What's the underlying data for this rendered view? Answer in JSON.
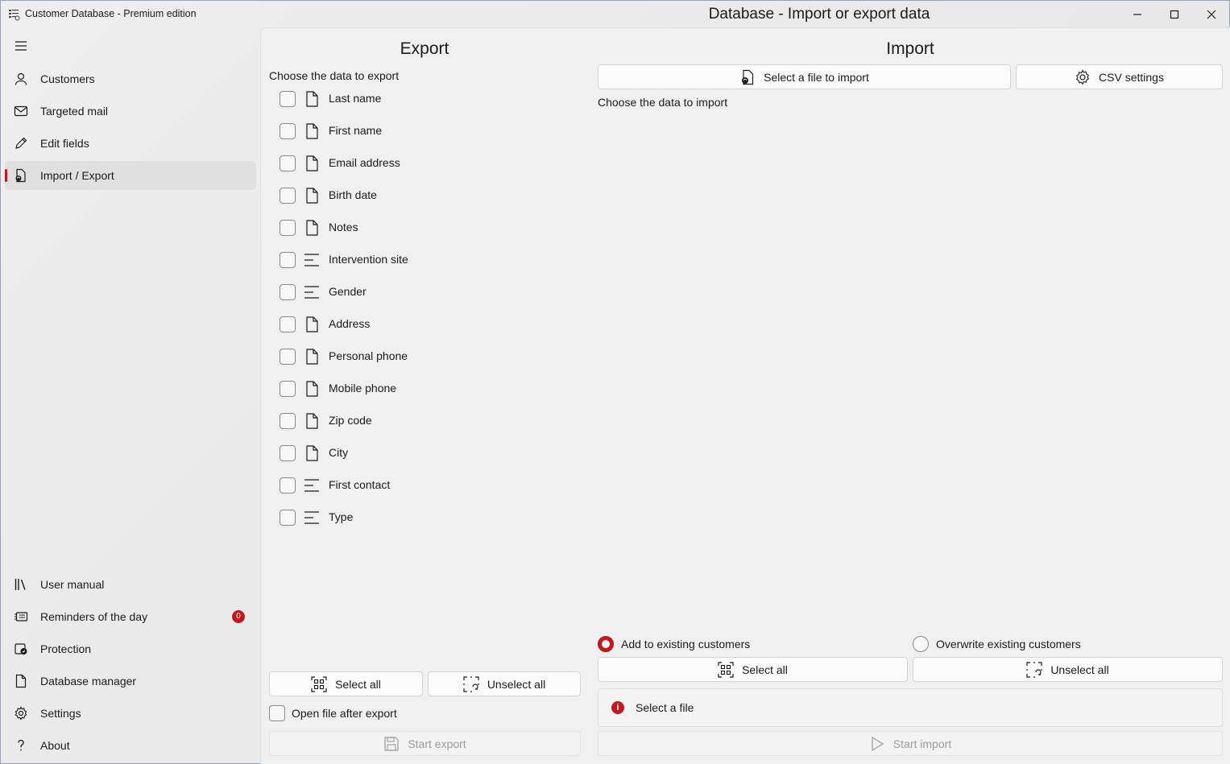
{
  "window": {
    "app_title": "Customer Database - Premium edition",
    "page_title": "Database - Import or export data"
  },
  "sidebar": {
    "top_items": [
      {
        "label": "Customers",
        "icon": "person-icon"
      },
      {
        "label": "Targeted mail",
        "icon": "mail-icon"
      },
      {
        "label": "Edit fields",
        "icon": "pencil-icon"
      },
      {
        "label": "Import / Export",
        "icon": "document-sync-icon",
        "selected": true
      }
    ],
    "bottom_items": [
      {
        "label": "User manual",
        "icon": "library-icon"
      },
      {
        "label": "Reminders of the day",
        "icon": "reminder-icon",
        "badge": "0"
      },
      {
        "label": "Protection",
        "icon": "shield-icon"
      },
      {
        "label": "Database manager",
        "icon": "document-icon"
      },
      {
        "label": "Settings",
        "icon": "gear-icon"
      },
      {
        "label": "About",
        "icon": "question-icon"
      }
    ]
  },
  "export": {
    "title": "Export",
    "choose_label": "Choose the data to export",
    "fields": [
      {
        "label": "Last name",
        "icon": "document-icon",
        "checked": false
      },
      {
        "label": "First name",
        "icon": "document-icon",
        "checked": false
      },
      {
        "label": "Email address",
        "icon": "document-icon",
        "checked": false
      },
      {
        "label": "Birth date",
        "icon": "document-icon",
        "checked": false
      },
      {
        "label": "Notes",
        "icon": "document-icon",
        "checked": false
      },
      {
        "label": "Intervention site",
        "icon": "lines-icon",
        "checked": false
      },
      {
        "label": "Gender",
        "icon": "lines-icon",
        "checked": false
      },
      {
        "label": "Address",
        "icon": "document-icon",
        "checked": false
      },
      {
        "label": "Personal phone",
        "icon": "document-icon",
        "checked": false
      },
      {
        "label": "Mobile phone",
        "icon": "document-icon",
        "checked": false
      },
      {
        "label": "Zip code",
        "icon": "document-icon",
        "checked": false
      },
      {
        "label": "City",
        "icon": "document-icon",
        "checked": false
      },
      {
        "label": "First contact",
        "icon": "lines-icon",
        "checked": false
      },
      {
        "label": "Type",
        "icon": "lines-icon",
        "checked": false
      }
    ],
    "select_all": "Select all",
    "unselect_all": "Unselect all",
    "open_after_export": "Open file after export",
    "start_export": "Start export"
  },
  "import": {
    "title": "Import",
    "select_file_button": "Select a file to import",
    "csv_settings_button": "CSV settings",
    "choose_label": "Choose the data to import",
    "mode_options": [
      {
        "label": "Add to existing customers",
        "selected": true
      },
      {
        "label": "Overwrite existing customers",
        "selected": false
      }
    ],
    "select_all": "Select all",
    "unselect_all": "Unselect all",
    "info_message": "Select a file",
    "start_import": "Start import"
  },
  "colors": {
    "accent": "#c4161c",
    "background": "#f0f0f0"
  }
}
